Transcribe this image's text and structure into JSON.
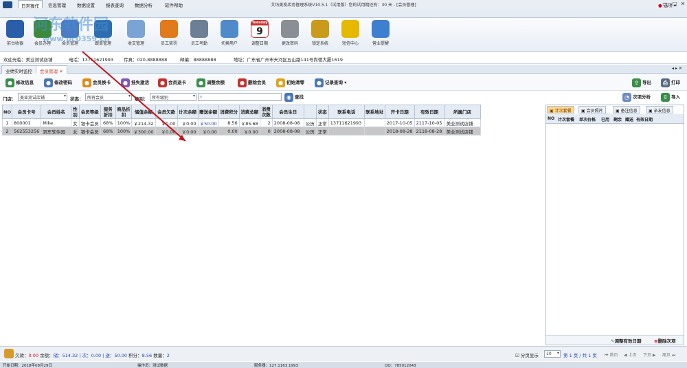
{
  "window": {
    "title": "艾玛美发店务管理系统V10.5.1（试用版）您的试用期还有：30 天 - [会员管理]",
    "menus": [
      "日常操作",
      "信息管理",
      "数据设置",
      "报表查询",
      "数据分析",
      "软件帮助"
    ],
    "skin_label": "选项"
  },
  "watermark": {
    "line1": "河东软件园",
    "line2": "www.pc0359.cn"
  },
  "ribbon": {
    "buttons": [
      {
        "label": "前台收银",
        "icon": "cash-register-icon",
        "color": "#2a5ea8"
      },
      {
        "label": "会员办理",
        "icon": "member-card-icon",
        "color": "#3c8a3c"
      },
      {
        "label": "会员管理",
        "icon": "member-manage-icon",
        "color": "#4a7dc4"
      },
      {
        "label": "跟单管理",
        "icon": "books-icon",
        "color": "#2f6db0"
      },
      {
        "label": "收支管理",
        "icon": "pencil-icon",
        "color": "#7aa4d6"
      },
      {
        "label": "员工奖罚",
        "icon": "badge-icon",
        "color": "#e07a1a"
      },
      {
        "label": "员工考勤",
        "icon": "clock-icon",
        "color": "#6d7f95"
      },
      {
        "label": "切换用户",
        "icon": "user-switch-icon",
        "color": "#4f8bc9"
      },
      {
        "label": "调整日期",
        "icon": "calendar-icon",
        "color": "#c9302c"
      },
      {
        "label": "更改密码",
        "icon": "key-icon",
        "color": "#8a8f96"
      },
      {
        "label": "锁定系统",
        "icon": "lock-icon",
        "color": "#c99a1c"
      },
      {
        "label": "短信中心",
        "icon": "mail-icon",
        "color": "#e6b800"
      },
      {
        "label": "营业提醒",
        "icon": "chat-icon",
        "color": "#3f7fd0"
      }
    ],
    "calendar_header": "Tuesday",
    "calendar_day": "9"
  },
  "info": {
    "welcome": "欢迎光临：美业测试店铺",
    "phone": "电话：13711621993",
    "fax": "传真：020-8888888",
    "post": "邮编：88888888",
    "address": "地址：广东省广州市天河区五山路141号尚德大厦1619"
  },
  "tabs": [
    {
      "label": "业绩实时监控"
    },
    {
      "label": "会员管理"
    }
  ],
  "toolbar": {
    "buttons": [
      "修改信息",
      "修改密码",
      "会员换卡",
      "挂失激活",
      "会员退卡",
      "调整余额",
      "删除会员",
      "初始清零",
      "记录查询"
    ],
    "export": "导出",
    "print": "打印",
    "analysis": "次项分析",
    "import": "导入"
  },
  "filter": {
    "store_label": "门店：",
    "store_value": "美业测试店铺",
    "status_label": "状态：",
    "status_value": "所有会员",
    "level_label": "级别：",
    "level_value": "所有级别",
    "search_placeholder": "",
    "search_button": "查找"
  },
  "table": {
    "columns": [
      "NO",
      "会员卡号",
      "会员姓名",
      "性别",
      "会员等级",
      "服务折扣",
      "商品折扣",
      "储值余额",
      "会员欠款",
      "计次余额",
      "赠送余额",
      "消费积分",
      "消费总额",
      "消费次数",
      "会员生日",
      "",
      "状态",
      "联系电话",
      "联系地址",
      "开卡日期",
      "有效日期",
      "所属门店"
    ],
    "rows": [
      [
        "1",
        "800001",
        "Mike",
        "女",
        "银卡会员",
        "68%",
        "100%",
        "￥214.32",
        "￥0.00",
        "￥0.00",
        "￥50.00",
        "8.56",
        "￥85.68",
        "2",
        "2008-08-08",
        "公历",
        "正常",
        "13711621993",
        "",
        "2017-10-05",
        "2117-10-05",
        "美业测试店铺"
      ],
      [
        "2",
        "562553256",
        "洞东软件园",
        "女",
        "银卡会员",
        "68%",
        "100%",
        "￥300.00",
        "￥0.00",
        "￥0.00",
        "￥0.00",
        "0.00",
        "￥0.00",
        "0",
        "2008-08-08",
        "公历",
        "正常",
        "",
        "",
        "2018-08-28",
        "2118-08-28",
        "美业测试店铺"
      ]
    ]
  },
  "right_panel": {
    "tabs": [
      "计次套餐",
      "会员照片",
      "备注信息",
      "亲友信息"
    ],
    "columns": [
      "NO",
      "计次套餐",
      "单次价格",
      "已用",
      "剩余",
      "赠送",
      "有效日期"
    ],
    "adjust_button": "调整有效日期",
    "delete_button": "删除次项"
  },
  "status": {
    "debt_label": "欠款：",
    "debt": "0.00",
    "balance_label": "余额：",
    "balance": "储：514.32 | 次：0.00 | 送：50.00",
    "points_label": "积分：",
    "points": "8.56",
    "count_label": "数量：",
    "count": "2",
    "paging_label": "分页显示",
    "page_size": "10",
    "page_info": "第 1 页 / 共 1 页",
    "first": "首页",
    "prev": "上页",
    "next": "下页",
    "last": "尾页"
  },
  "taskbar": {
    "date": "开始日期：2018年08月29日",
    "operator": "操作员：测试数据",
    "server": "服务器：127.1163.1993",
    "qq": "QQ：785012043"
  }
}
